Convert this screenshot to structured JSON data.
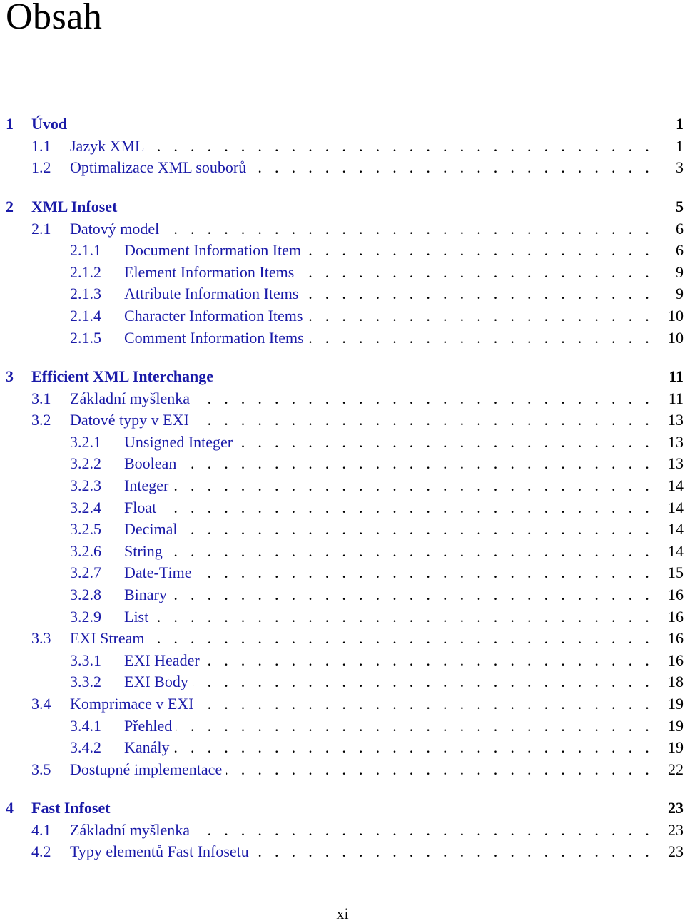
{
  "page": {
    "title": "Obsah",
    "page_number": "xi",
    "link_color": "#1a1aa8",
    "text_color": "#000000"
  },
  "toc": [
    {
      "level": "chapter",
      "number": "1",
      "label": "Úvod",
      "page": "1"
    },
    {
      "level": "section",
      "number": "1.1",
      "label": "Jazyk XML",
      "page": "1"
    },
    {
      "level": "section",
      "number": "1.2",
      "label": "Optimalizace XML souborů",
      "page": "3"
    },
    {
      "level": "chapter",
      "number": "2",
      "label": "XML Infoset",
      "page": "5"
    },
    {
      "level": "section",
      "number": "2.1",
      "label": "Datový model",
      "page": "6"
    },
    {
      "level": "subsection",
      "number": "2.1.1",
      "label": "Document Information Item",
      "page": "6"
    },
    {
      "level": "subsection",
      "number": "2.1.2",
      "label": "Element Information Items",
      "page": "9"
    },
    {
      "level": "subsection",
      "number": "2.1.3",
      "label": "Attribute Information Items",
      "page": "9"
    },
    {
      "level": "subsection",
      "number": "2.1.4",
      "label": "Character Information Items",
      "page": "10"
    },
    {
      "level": "subsection",
      "number": "2.1.5",
      "label": "Comment Information Items",
      "page": "10"
    },
    {
      "level": "chapter",
      "number": "3",
      "label": "Efficient XML Interchange",
      "page": "11"
    },
    {
      "level": "section",
      "number": "3.1",
      "label": "Základní myšlenka",
      "page": "11"
    },
    {
      "level": "section",
      "number": "3.2",
      "label": "Datové typy v EXI",
      "page": "13"
    },
    {
      "level": "subsection",
      "number": "3.2.1",
      "label": "Unsigned Integer",
      "page": "13"
    },
    {
      "level": "subsection",
      "number": "3.2.2",
      "label": "Boolean",
      "page": "13"
    },
    {
      "level": "subsection",
      "number": "3.2.3",
      "label": "Integer",
      "page": "14"
    },
    {
      "level": "subsection",
      "number": "3.2.4",
      "label": "Float",
      "page": "14"
    },
    {
      "level": "subsection",
      "number": "3.2.5",
      "label": "Decimal",
      "page": "14"
    },
    {
      "level": "subsection",
      "number": "3.2.6",
      "label": "String",
      "page": "14"
    },
    {
      "level": "subsection",
      "number": "3.2.7",
      "label": "Date-Time",
      "page": "15"
    },
    {
      "level": "subsection",
      "number": "3.2.8",
      "label": "Binary",
      "page": "16"
    },
    {
      "level": "subsection",
      "number": "3.2.9",
      "label": "List",
      "page": "16"
    },
    {
      "level": "section",
      "number": "3.3",
      "label": "EXI Stream",
      "page": "16"
    },
    {
      "level": "subsection",
      "number": "3.3.1",
      "label": "EXI Header",
      "page": "16"
    },
    {
      "level": "subsection",
      "number": "3.3.2",
      "label": "EXI Body",
      "page": "18"
    },
    {
      "level": "section",
      "number": "3.4",
      "label": "Komprimace v EXI",
      "page": "19"
    },
    {
      "level": "subsection",
      "number": "3.4.1",
      "label": "Přehled",
      "page": "19"
    },
    {
      "level": "subsection",
      "number": "3.4.2",
      "label": "Kanály",
      "page": "19"
    },
    {
      "level": "section",
      "number": "3.5",
      "label": "Dostupné implementace",
      "page": "22"
    },
    {
      "level": "chapter",
      "number": "4",
      "label": "Fast Infoset",
      "page": "23"
    },
    {
      "level": "section",
      "number": "4.1",
      "label": "Základní myšlenka",
      "page": "23"
    },
    {
      "level": "section",
      "number": "4.2",
      "label": "Typy elementů Fast Infosetu",
      "page": "23"
    }
  ]
}
